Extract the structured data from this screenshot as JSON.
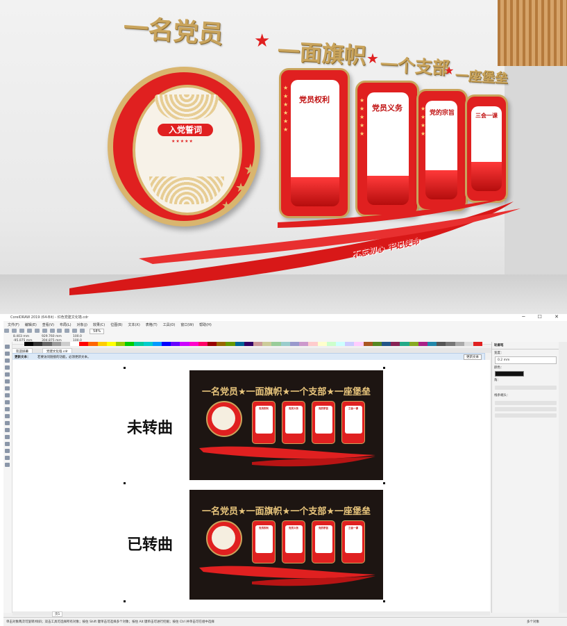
{
  "render": {
    "slogans": [
      "一名党员",
      "一面旗帜",
      "一个支部",
      "一座堡垒"
    ],
    "oath_title": "入党誓词",
    "panels": [
      "党员权利",
      "党员义务",
      "党的宗旨",
      "三会一课"
    ],
    "ribbon_text": "不忘初心 牢记使命"
  },
  "app": {
    "title": "CorelDRAW 2019 (64-Bit) - 红色党建文化墙.cdr",
    "menu": [
      "文件(F)",
      "编辑(E)",
      "查看(V)",
      "布局(L)",
      "对象(J)",
      "效果(C)",
      "位图(B)",
      "文本(X)",
      "表格(T)",
      "工具(O)",
      "窗口(W)",
      "帮助(H)"
    ],
    "zoom": "58%",
    "coords": {
      "x": "8.403 mm",
      "y": "-95.075 mm",
      "w": "929.760 mm",
      "h": "304.875 mm",
      "sx": "100.0",
      "sy": "100.0"
    },
    "tabs": [
      "欢迎屏幕",
      "党建文化墙.cdr"
    ],
    "info_left": "更新文本：",
    "info_msg": "若要访问链接的功能，必须更新文本。",
    "info_btn": "更新文本",
    "right_panel": {
      "title": "轮廓笔",
      "width_label": "宽度：",
      "width_value": "0.2 mm",
      "color_label": "颜色：",
      "corner_label": "角：",
      "line_label": "线条端头："
    },
    "status_left": "单击对象两次可旋转/倾斜；双击工具可选择所有对象；按住 Shift 键单击可选择多个对象；按住 Alt 键单击可进行挖掘；按住 Ctrl 并单击可在组中选择",
    "status_right": "多个对象",
    "page_tab": "页1"
  },
  "canvas": {
    "label_top": "未转曲",
    "label_bottom": "已转曲",
    "art_heading": "一名党员★一面旗帜★一个支部★一座堡垒",
    "art_panels": [
      "党员权利",
      "党员义务",
      "党的宗旨",
      "三会一课"
    ]
  },
  "colors": {
    "accent": "#e02020",
    "gold": "#c9a45c",
    "dark": "#1d1512"
  }
}
